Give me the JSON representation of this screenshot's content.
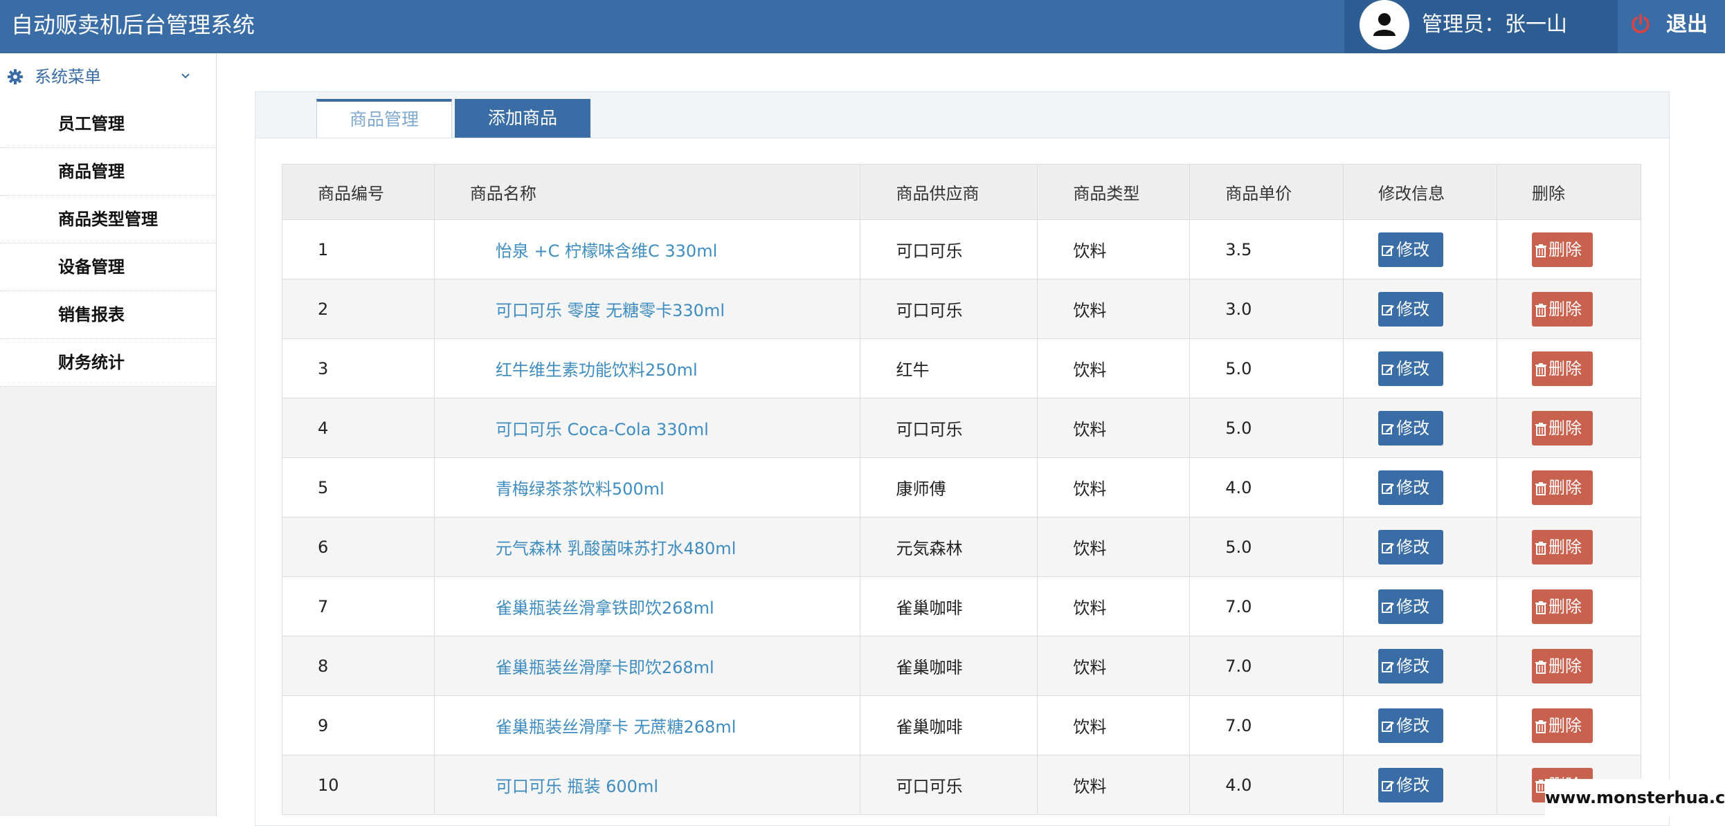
{
  "header": {
    "app_title": "自动贩卖机后台管理系统",
    "admin_label": "管理员：张一山",
    "logout_label": "退出"
  },
  "sidebar": {
    "menu_title": "系统菜单",
    "items": [
      {
        "label": "员工管理"
      },
      {
        "label": "商品管理"
      },
      {
        "label": "商品类型管理"
      },
      {
        "label": "设备管理"
      },
      {
        "label": "销售报表"
      },
      {
        "label": "财务统计"
      }
    ]
  },
  "tabs": [
    {
      "label": "商品管理",
      "active": true
    },
    {
      "label": "添加商品",
      "active": false
    }
  ],
  "table": {
    "columns": [
      "商品编号",
      "商品名称",
      "商品供应商",
      "商品类型",
      "商品单价",
      "修改信息",
      "删除"
    ],
    "edit_label": "修改",
    "delete_label": "删除",
    "rows": [
      {
        "id": "1",
        "name": "怡泉 +C 柠檬味含维C 330ml",
        "supplier": "可口可乐",
        "type": "饮料",
        "price": "3.5"
      },
      {
        "id": "2",
        "name": "可口可乐 零度 无糖零卡330ml",
        "supplier": "可口可乐",
        "type": "饮料",
        "price": "3.0"
      },
      {
        "id": "3",
        "name": "红牛维生素功能饮料250ml",
        "supplier": "红牛",
        "type": "饮料",
        "price": "5.0"
      },
      {
        "id": "4",
        "name": "可口可乐 Coca-Cola 330ml",
        "supplier": "可口可乐",
        "type": "饮料",
        "price": "5.0"
      },
      {
        "id": "5",
        "name": "青梅绿茶茶饮料500ml",
        "supplier": "康师傅",
        "type": "饮料",
        "price": "4.0"
      },
      {
        "id": "6",
        "name": "元气森林 乳酸菌味苏打水480ml",
        "supplier": "元気森林",
        "type": "饮料",
        "price": "5.0"
      },
      {
        "id": "7",
        "name": "雀巢瓶装丝滑拿铁即饮268ml",
        "supplier": "雀巢咖啡",
        "type": "饮料",
        "price": "7.0"
      },
      {
        "id": "8",
        "name": "雀巢瓶装丝滑摩卡即饮268ml",
        "supplier": "雀巢咖啡",
        "type": "饮料",
        "price": "7.0"
      },
      {
        "id": "9",
        "name": "雀巢瓶装丝滑摩卡 无蔗糖268ml",
        "supplier": "雀巢咖啡",
        "type": "饮料",
        "price": "7.0"
      },
      {
        "id": "10",
        "name": "可口可乐 瓶装 600ml",
        "supplier": "可口可乐",
        "type": "饮料",
        "price": "4.0"
      }
    ]
  },
  "watermark": "www.monsterhua.com",
  "colors": {
    "primary": "#3a6da5",
    "primary_dark": "#2d5d92",
    "danger": "#c8614e",
    "link": "#3f8dc0"
  }
}
